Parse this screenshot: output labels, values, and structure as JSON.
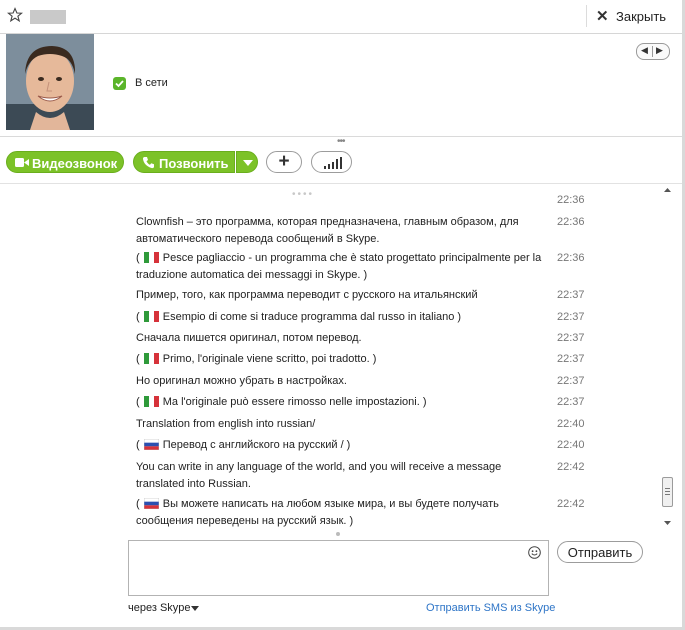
{
  "header": {
    "close_label": "Закрыть"
  },
  "profile": {
    "status_text": "В сети"
  },
  "call_bar": {
    "video_call_label": "Видеозвонок",
    "call_label": "Позвонить",
    "add_label": "+"
  },
  "messages": [
    {
      "text": "Clownfish – это программа, которая предназначена, главным образом, для автоматического перевода сообщений в Skype.",
      "time": "22:36",
      "flag": null
    },
    {
      "text": "Pesce pagliaccio - un programma che è stato progettato principalmente per la traduzione automatica dei messaggi in Skype. )",
      "time": "22:36",
      "flag": "it"
    },
    {
      "text": "Пример, того, как программа переводит с русского на итальянский",
      "time": "22:37",
      "flag": null
    },
    {
      "text": "Esempio di come si traduce programma dal russo in italiano )",
      "time": "22:37",
      "flag": "it"
    },
    {
      "text": "Сначала пишется оригинал, потом перевод.",
      "time": "22:37",
      "flag": null
    },
    {
      "text": "Primo, l'originale viene scritto, poi tradotto. )",
      "time": "22:37",
      "flag": "it"
    },
    {
      "text": "Но оригинал можно убрать в настройках.",
      "time": "22:37",
      "flag": null
    },
    {
      "text": "Ma l'originale può essere rimosso nelle impostazioni. )",
      "time": "22:37",
      "flag": "it"
    },
    {
      "text": "Translation from english into russian/",
      "time": "22:40",
      "flag": null
    },
    {
      "text": "Перевод с английского на русский / )",
      "time": "22:40",
      "flag": "ru"
    },
    {
      "text": "You can write in any language of the world, and you will receive a message translated into Russian.",
      "time": "22:42",
      "flag": null
    },
    {
      "text": "Вы можете написать на любом языке мира, и вы будете получать сообщения переведены на русский язык. )",
      "time": "22:42",
      "flag": "ru"
    }
  ],
  "top_partial_time": "22:36",
  "flag_prefix": "(",
  "compose": {
    "send_label": "Отправить",
    "via_label": "через Skype",
    "sms_link": "Отправить SMS из Skype"
  },
  "colors": {
    "accent_green": "#7cc228",
    "link_blue": "#2e75c7",
    "status_green": "#5bb52a"
  }
}
